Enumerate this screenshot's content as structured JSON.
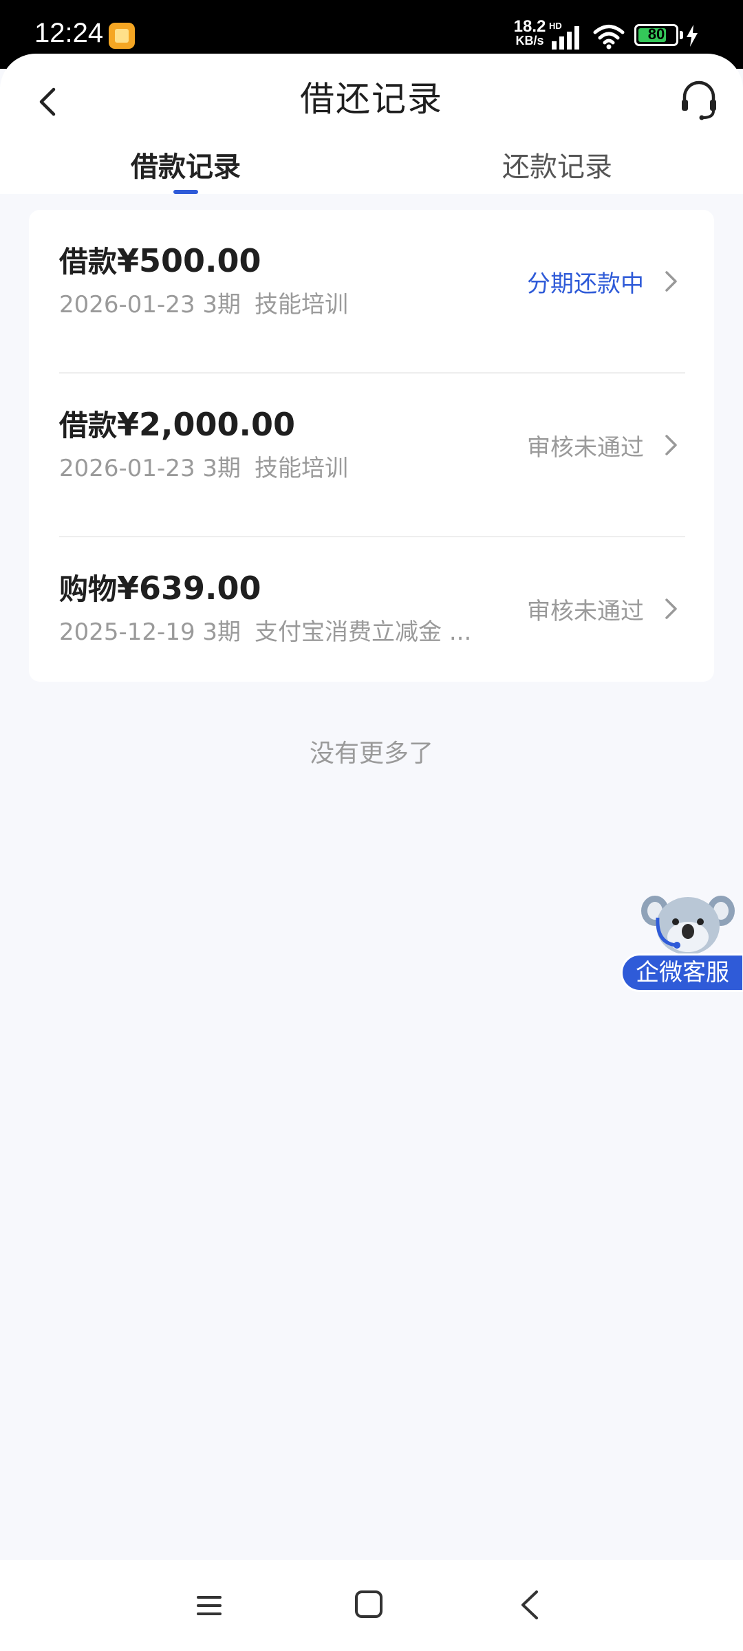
{
  "status_bar": {
    "time": "12:24",
    "net_speed_value": "18.2",
    "net_speed_unit": "KB/s",
    "network_label": "HD",
    "battery_level": "80",
    "icons": [
      "notification-app-icon",
      "signal-icon",
      "wifi-icon",
      "battery-icon",
      "charging-bolt-icon"
    ]
  },
  "header": {
    "title": "借还记录",
    "back_icon": "chevron-left-icon",
    "support_icon": "headset-icon"
  },
  "tabs": [
    {
      "label": "借款记录",
      "active": true
    },
    {
      "label": "还款记录",
      "active": false
    }
  ],
  "records": [
    {
      "type_label": "借款",
      "amount": "¥500.00",
      "date": "2026-01-23",
      "installments": "3期",
      "purpose": "技能培训",
      "status": "分期还款中",
      "status_color": "#2f5bd8"
    },
    {
      "type_label": "借款",
      "amount": "¥2,000.00",
      "date": "2026-01-23",
      "installments": "3期",
      "purpose": "技能培训",
      "status": "审核未通过",
      "status_color": "#9a9a9a"
    },
    {
      "type_label": "购物",
      "amount": "¥639.00",
      "date": "2025-12-19",
      "installments": "3期",
      "purpose": "支付宝消费立减金 ...",
      "status": "审核未通过",
      "status_color": "#9a9a9a"
    }
  ],
  "list_end_text": "没有更多了",
  "float_service": {
    "label": "企微客服",
    "icon": "koala-mascot-icon"
  },
  "nav_bar": {
    "icons": [
      "menu-icon",
      "home-square-icon",
      "back-triangle-icon"
    ]
  },
  "colors": {
    "accent": "#2f5bd8",
    "background": "#f7f8fc",
    "card": "#ffffff",
    "muted_text": "#9a9a9a"
  }
}
